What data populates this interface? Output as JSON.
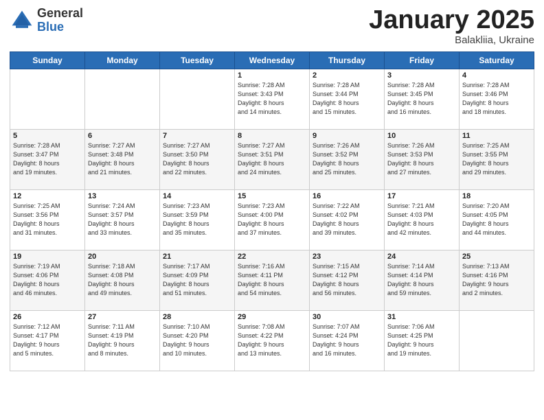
{
  "header": {
    "logo_general": "General",
    "logo_blue": "Blue",
    "month_title": "January 2025",
    "subtitle": "Balakliia, Ukraine"
  },
  "days_of_week": [
    "Sunday",
    "Monday",
    "Tuesday",
    "Wednesday",
    "Thursday",
    "Friday",
    "Saturday"
  ],
  "weeks": [
    [
      {
        "day": "",
        "info": ""
      },
      {
        "day": "",
        "info": ""
      },
      {
        "day": "",
        "info": ""
      },
      {
        "day": "1",
        "info": "Sunrise: 7:28 AM\nSunset: 3:43 PM\nDaylight: 8 hours\nand 14 minutes."
      },
      {
        "day": "2",
        "info": "Sunrise: 7:28 AM\nSunset: 3:44 PM\nDaylight: 8 hours\nand 15 minutes."
      },
      {
        "day": "3",
        "info": "Sunrise: 7:28 AM\nSunset: 3:45 PM\nDaylight: 8 hours\nand 16 minutes."
      },
      {
        "day": "4",
        "info": "Sunrise: 7:28 AM\nSunset: 3:46 PM\nDaylight: 8 hours\nand 18 minutes."
      }
    ],
    [
      {
        "day": "5",
        "info": "Sunrise: 7:28 AM\nSunset: 3:47 PM\nDaylight: 8 hours\nand 19 minutes."
      },
      {
        "day": "6",
        "info": "Sunrise: 7:27 AM\nSunset: 3:48 PM\nDaylight: 8 hours\nand 21 minutes."
      },
      {
        "day": "7",
        "info": "Sunrise: 7:27 AM\nSunset: 3:50 PM\nDaylight: 8 hours\nand 22 minutes."
      },
      {
        "day": "8",
        "info": "Sunrise: 7:27 AM\nSunset: 3:51 PM\nDaylight: 8 hours\nand 24 minutes."
      },
      {
        "day": "9",
        "info": "Sunrise: 7:26 AM\nSunset: 3:52 PM\nDaylight: 8 hours\nand 25 minutes."
      },
      {
        "day": "10",
        "info": "Sunrise: 7:26 AM\nSunset: 3:53 PM\nDaylight: 8 hours\nand 27 minutes."
      },
      {
        "day": "11",
        "info": "Sunrise: 7:25 AM\nSunset: 3:55 PM\nDaylight: 8 hours\nand 29 minutes."
      }
    ],
    [
      {
        "day": "12",
        "info": "Sunrise: 7:25 AM\nSunset: 3:56 PM\nDaylight: 8 hours\nand 31 minutes."
      },
      {
        "day": "13",
        "info": "Sunrise: 7:24 AM\nSunset: 3:57 PM\nDaylight: 8 hours\nand 33 minutes."
      },
      {
        "day": "14",
        "info": "Sunrise: 7:23 AM\nSunset: 3:59 PM\nDaylight: 8 hours\nand 35 minutes."
      },
      {
        "day": "15",
        "info": "Sunrise: 7:23 AM\nSunset: 4:00 PM\nDaylight: 8 hours\nand 37 minutes."
      },
      {
        "day": "16",
        "info": "Sunrise: 7:22 AM\nSunset: 4:02 PM\nDaylight: 8 hours\nand 39 minutes."
      },
      {
        "day": "17",
        "info": "Sunrise: 7:21 AM\nSunset: 4:03 PM\nDaylight: 8 hours\nand 42 minutes."
      },
      {
        "day": "18",
        "info": "Sunrise: 7:20 AM\nSunset: 4:05 PM\nDaylight: 8 hours\nand 44 minutes."
      }
    ],
    [
      {
        "day": "19",
        "info": "Sunrise: 7:19 AM\nSunset: 4:06 PM\nDaylight: 8 hours\nand 46 minutes."
      },
      {
        "day": "20",
        "info": "Sunrise: 7:18 AM\nSunset: 4:08 PM\nDaylight: 8 hours\nand 49 minutes."
      },
      {
        "day": "21",
        "info": "Sunrise: 7:17 AM\nSunset: 4:09 PM\nDaylight: 8 hours\nand 51 minutes."
      },
      {
        "day": "22",
        "info": "Sunrise: 7:16 AM\nSunset: 4:11 PM\nDaylight: 8 hours\nand 54 minutes."
      },
      {
        "day": "23",
        "info": "Sunrise: 7:15 AM\nSunset: 4:12 PM\nDaylight: 8 hours\nand 56 minutes."
      },
      {
        "day": "24",
        "info": "Sunrise: 7:14 AM\nSunset: 4:14 PM\nDaylight: 8 hours\nand 59 minutes."
      },
      {
        "day": "25",
        "info": "Sunrise: 7:13 AM\nSunset: 4:16 PM\nDaylight: 9 hours\nand 2 minutes."
      }
    ],
    [
      {
        "day": "26",
        "info": "Sunrise: 7:12 AM\nSunset: 4:17 PM\nDaylight: 9 hours\nand 5 minutes."
      },
      {
        "day": "27",
        "info": "Sunrise: 7:11 AM\nSunset: 4:19 PM\nDaylight: 9 hours\nand 8 minutes."
      },
      {
        "day": "28",
        "info": "Sunrise: 7:10 AM\nSunset: 4:20 PM\nDaylight: 9 hours\nand 10 minutes."
      },
      {
        "day": "29",
        "info": "Sunrise: 7:08 AM\nSunset: 4:22 PM\nDaylight: 9 hours\nand 13 minutes."
      },
      {
        "day": "30",
        "info": "Sunrise: 7:07 AM\nSunset: 4:24 PM\nDaylight: 9 hours\nand 16 minutes."
      },
      {
        "day": "31",
        "info": "Sunrise: 7:06 AM\nSunset: 4:25 PM\nDaylight: 9 hours\nand 19 minutes."
      },
      {
        "day": "",
        "info": ""
      }
    ]
  ]
}
